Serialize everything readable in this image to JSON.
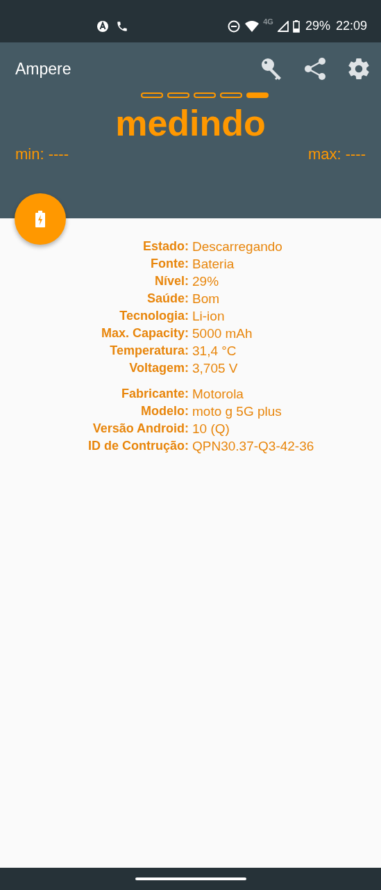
{
  "status_bar": {
    "network": "4G",
    "battery": "29%",
    "time": "22:09"
  },
  "app_bar": {
    "title": "Ampere"
  },
  "pages": [
    {
      "selected": false
    },
    {
      "selected": false
    },
    {
      "selected": false
    },
    {
      "selected": false
    },
    {
      "selected": true
    }
  ],
  "reading": "medindo",
  "min": "min: ----",
  "max": "max: ----",
  "groups": [
    [
      {
        "label": "Estado:",
        "value": "Descarregando"
      },
      {
        "label": "Fonte:",
        "value": "Bateria"
      },
      {
        "label": "Nível:",
        "value": "29%"
      },
      {
        "label": "Saúde:",
        "value": "Bom"
      },
      {
        "label": "Tecnologia:",
        "value": "Li-ion"
      },
      {
        "label": "Max. Capacity:",
        "value": "5000 mAh"
      },
      {
        "label": "Temperatura:",
        "value": "31,4 °C"
      },
      {
        "label": "Voltagem:",
        "value": "3,705 V"
      }
    ],
    [
      {
        "label": "Fabricante:",
        "value": "Motorola"
      },
      {
        "label": "Modelo:",
        "value": "moto g 5G plus"
      },
      {
        "label": "Versão Android:",
        "value": "10 (Q)"
      },
      {
        "label": "ID de Contrução:",
        "value": "QPN30.37-Q3-42-36"
      }
    ]
  ]
}
